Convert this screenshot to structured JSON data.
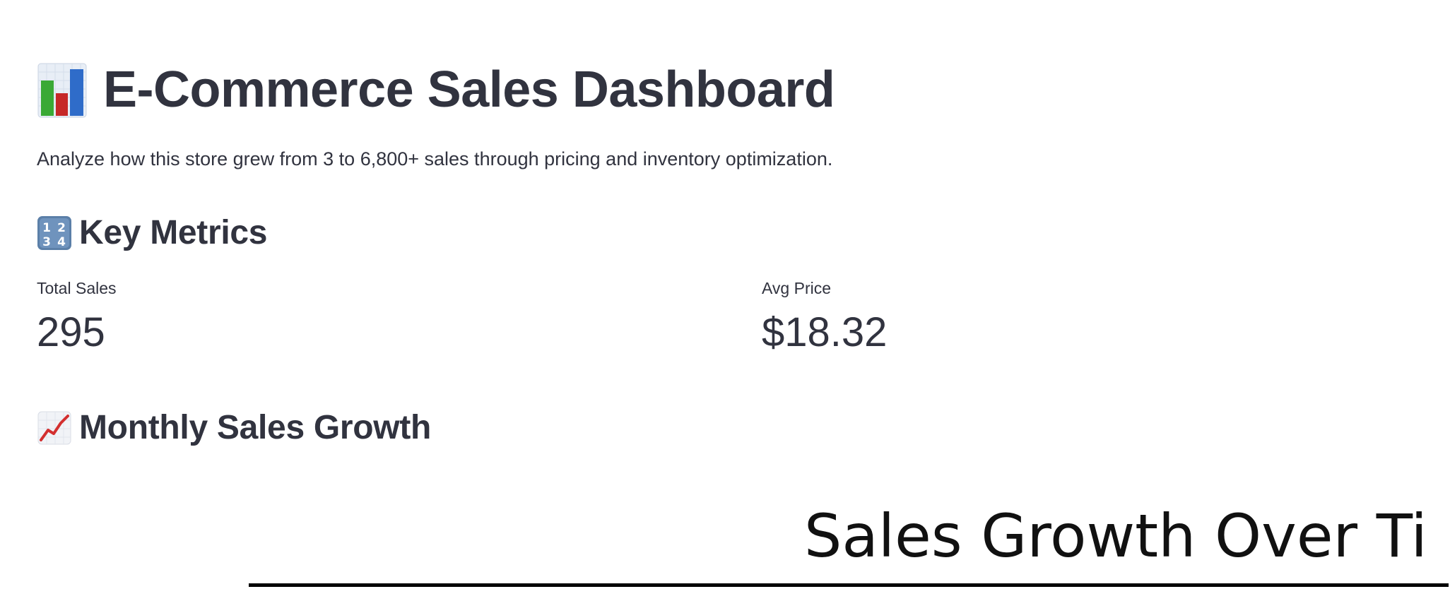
{
  "header": {
    "icon": "bar-chart-emoji",
    "title": "E-Commerce Sales Dashboard",
    "subtitle": "Analyze how this store grew from 3 to 6,800+ sales through pricing and inventory optimization."
  },
  "key_metrics": {
    "icon": "numbers-emoji",
    "heading": "Key Metrics",
    "items": [
      {
        "label": "Total Sales",
        "value": "295"
      },
      {
        "label": "Avg Price",
        "value": "$18.32"
      }
    ]
  },
  "growth": {
    "icon": "chart-increasing-emoji",
    "heading": "Monthly Sales Growth"
  },
  "chart_data": {
    "type": "line",
    "title": "Sales Growth Over Ti",
    "series": []
  }
}
